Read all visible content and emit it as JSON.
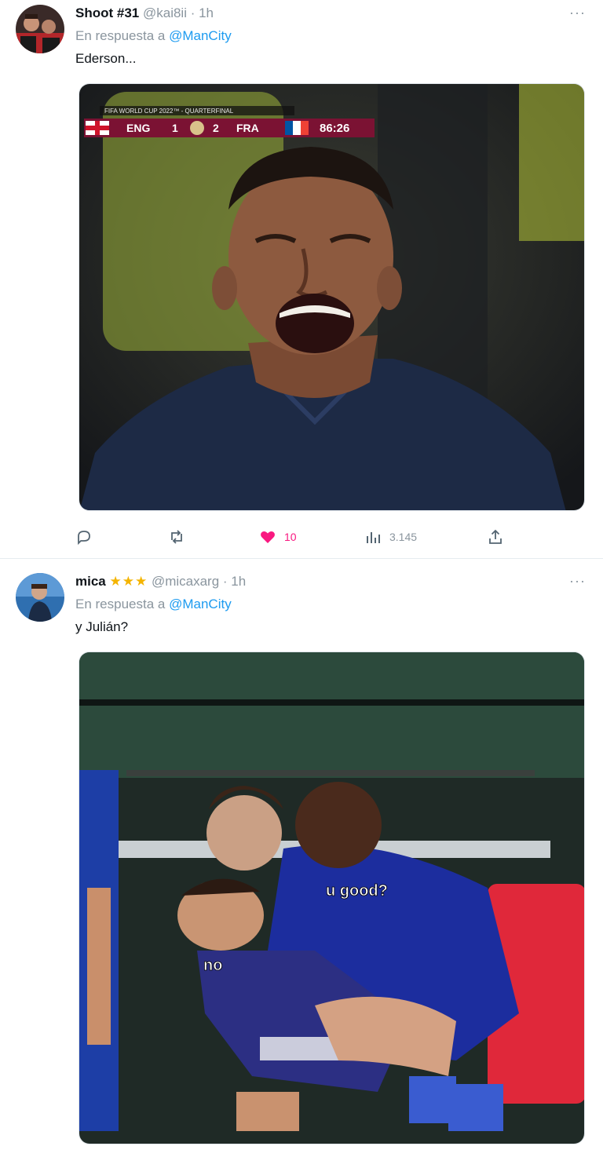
{
  "tweets": [
    {
      "author": {
        "display_name": "Shoot #31",
        "handle": "@kai8ii",
        "time": "· 1h"
      },
      "reply_prefix": "En respuesta a",
      "reply_to": "@ManCity",
      "text": "Ederson...",
      "more": "···",
      "media": {
        "scorebug": {
          "competition": "FIFA WORLD CUP 2022™ - QUARTERFINAL",
          "home": "ENG",
          "home_score": "1",
          "away_score": "2",
          "away": "FRA",
          "clock": "86:26"
        }
      },
      "actions": {
        "reply_icon": "reply-icon",
        "retweet_icon": "retweet-icon",
        "like_icon": "heart-filled-icon",
        "likes": "10",
        "views_icon": "views-icon",
        "views": "3.145",
        "share_icon": "share-icon"
      }
    },
    {
      "author": {
        "display_name": "mica",
        "stars": "★★★",
        "handle": "@micaxarg",
        "time": "· 1h"
      },
      "reply_prefix": "En respuesta a",
      "reply_to": "@ManCity",
      "text": "y Julián?",
      "more": "···",
      "media": {
        "captions": {
          "top": "u good?",
          "bottom": "no"
        }
      }
    }
  ],
  "colors": {
    "accent": "#1d9bf0",
    "like": "#f91880",
    "muted": "#8a959e",
    "star": "#f4b400"
  }
}
